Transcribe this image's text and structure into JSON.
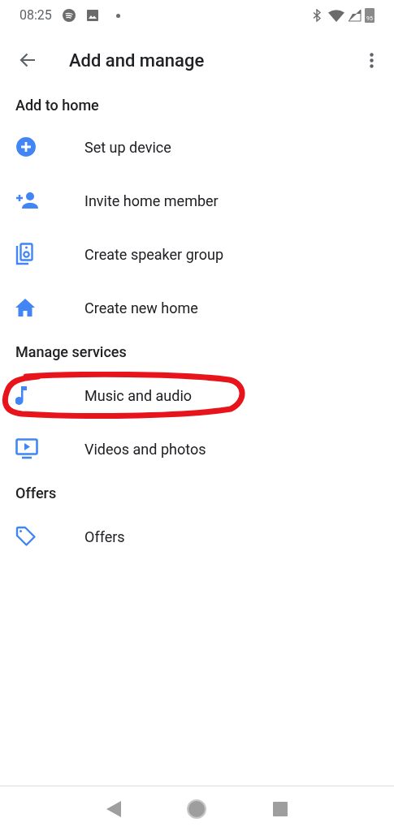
{
  "status_bar": {
    "time": "08:25",
    "battery": "95"
  },
  "app_bar": {
    "title": "Add and manage"
  },
  "sections": [
    {
      "heading": "Add to home",
      "items": [
        {
          "label": "Set up device",
          "kind": "add-circle",
          "circled": false
        },
        {
          "label": "Invite home member",
          "kind": "person-add",
          "circled": false
        },
        {
          "label": "Create speaker group",
          "kind": "speakers",
          "circled": false
        },
        {
          "label": "Create new home",
          "kind": "home",
          "circled": false
        }
      ]
    },
    {
      "heading": "Manage services",
      "items": [
        {
          "label": "Music and audio",
          "kind": "music",
          "circled": true
        },
        {
          "label": "Videos and photos",
          "kind": "video",
          "circled": false
        }
      ]
    },
    {
      "heading": "Offers",
      "items": [
        {
          "label": "Offers",
          "kind": "tag",
          "circled": false
        }
      ]
    }
  ]
}
